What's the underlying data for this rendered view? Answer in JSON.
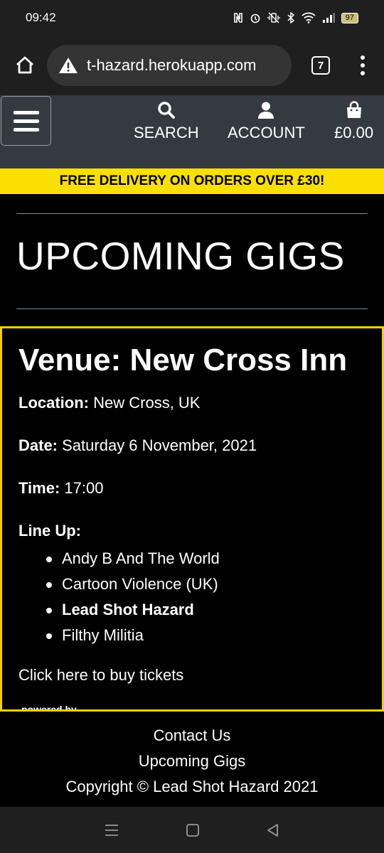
{
  "status_bar": {
    "time": "09:42",
    "battery": "97",
    "icons": [
      "nfc-icon",
      "alarm-icon",
      "vibrate-icon",
      "bluetooth-icon",
      "wifi-icon",
      "signal-icon",
      "battery-icon"
    ]
  },
  "browser": {
    "url": "t-hazard.herokuapp.com",
    "tab_count": "7",
    "icons": [
      "home-icon",
      "warning-icon",
      "more-icon"
    ]
  },
  "header": {
    "nav": {
      "search": "SEARCH",
      "account": "ACCOUNT",
      "bag": "£0.00"
    },
    "icons": [
      "hamburger-icon",
      "search-icon",
      "user-icon",
      "shopping-bag-icon"
    ]
  },
  "banner": {
    "text": "FREE DELIVERY ON ORDERS OVER £30!"
  },
  "page": {
    "title": "UPCOMING GIGS"
  },
  "gig": {
    "venue": "Venue: New Cross Inn",
    "location_label": "Location:",
    "location": "New Cross, UK",
    "date_label": "Date:",
    "date": "Saturday 6 November, 2021",
    "time_label": "Time:",
    "time": "17:00",
    "lineup_label": "Line Up:",
    "lineup": [
      "Andy B And The World",
      "Cartoon Violence (UK)",
      "Lead Shot Hazard",
      "Filthy Militia"
    ],
    "tickets_link": "Click here to buy tickets",
    "powered_by": "powered by"
  },
  "footer": {
    "contact": "Contact Us",
    "gigs": "Upcoming Gigs",
    "copyright": "Copyright © Lead Shot Hazard 2021"
  },
  "colors": {
    "accent_yellow": "#f9e000",
    "header_bg": "#343a40",
    "card_border": "#f4d000"
  }
}
